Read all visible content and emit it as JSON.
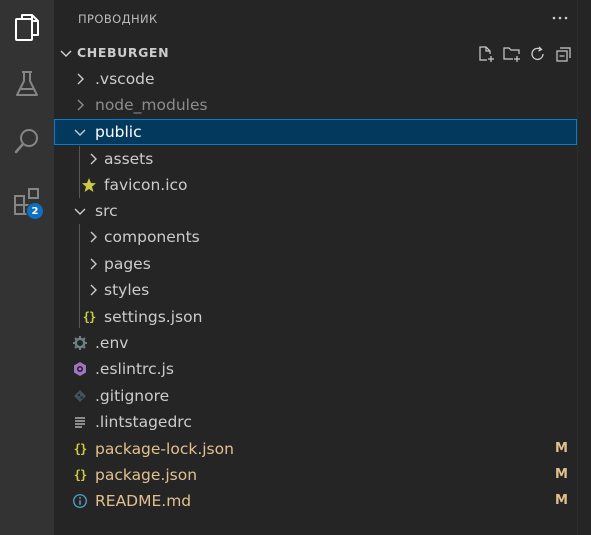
{
  "activity_bar": {
    "items": [
      {
        "name": "explorer",
        "icon": "files-icon",
        "active": true
      },
      {
        "name": "testing",
        "icon": "beaker-icon"
      },
      {
        "name": "search",
        "icon": "search-icon"
      },
      {
        "name": "extensions",
        "icon": "extensions-icon",
        "badge": "2"
      }
    ],
    "badge_color": "#0e70c0"
  },
  "explorer": {
    "title": "ПРОВОДНИК",
    "more_icon": "ellipsis-icon",
    "section": {
      "title": "CHEBURGEN",
      "actions": [
        "new-file-icon",
        "new-folder-icon",
        "refresh-icon",
        "collapse-all-icon"
      ]
    },
    "tree": [
      {
        "label": ".vscode",
        "type": "folder",
        "expanded": false,
        "depth": 0
      },
      {
        "label": "node_modules",
        "type": "folder",
        "expanded": false,
        "depth": 0,
        "ignored": true
      },
      {
        "label": "public",
        "type": "folder",
        "expanded": true,
        "depth": 0,
        "selected": true
      },
      {
        "label": "assets",
        "type": "folder",
        "expanded": false,
        "depth": 1
      },
      {
        "label": "favicon.ico",
        "type": "file",
        "icon": "star-icon",
        "depth": 1
      },
      {
        "label": "src",
        "type": "folder",
        "expanded": true,
        "depth": 0
      },
      {
        "label": "components",
        "type": "folder",
        "expanded": false,
        "depth": 1
      },
      {
        "label": "pages",
        "type": "folder",
        "expanded": false,
        "depth": 1
      },
      {
        "label": "styles",
        "type": "folder",
        "expanded": false,
        "depth": 1
      },
      {
        "label": "settings.json",
        "type": "file",
        "icon": "json-icon",
        "depth": 1
      },
      {
        "label": ".env",
        "type": "file",
        "icon": "gear-icon",
        "depth": 0
      },
      {
        "label": ".eslintrc.js",
        "type": "file",
        "icon": "eslint-icon",
        "depth": 0
      },
      {
        "label": ".gitignore",
        "type": "file",
        "icon": "git-icon",
        "depth": 0
      },
      {
        "label": ".lintstagedrc",
        "type": "file",
        "icon": "lines-icon",
        "depth": 0
      },
      {
        "label": "package-lock.json",
        "type": "file",
        "icon": "json-icon",
        "depth": 0,
        "status": "M"
      },
      {
        "label": "package.json",
        "type": "file",
        "icon": "json-icon",
        "depth": 0,
        "status": "M"
      },
      {
        "label": "README.md",
        "type": "file",
        "icon": "info-icon",
        "depth": 0,
        "status": "M"
      }
    ]
  },
  "colors": {
    "selection_bg": "#04395e",
    "selection_border": "#007fd4",
    "modified": "#e2c08d",
    "ignored": "#8c8c8c",
    "json": "#cbcb41"
  }
}
